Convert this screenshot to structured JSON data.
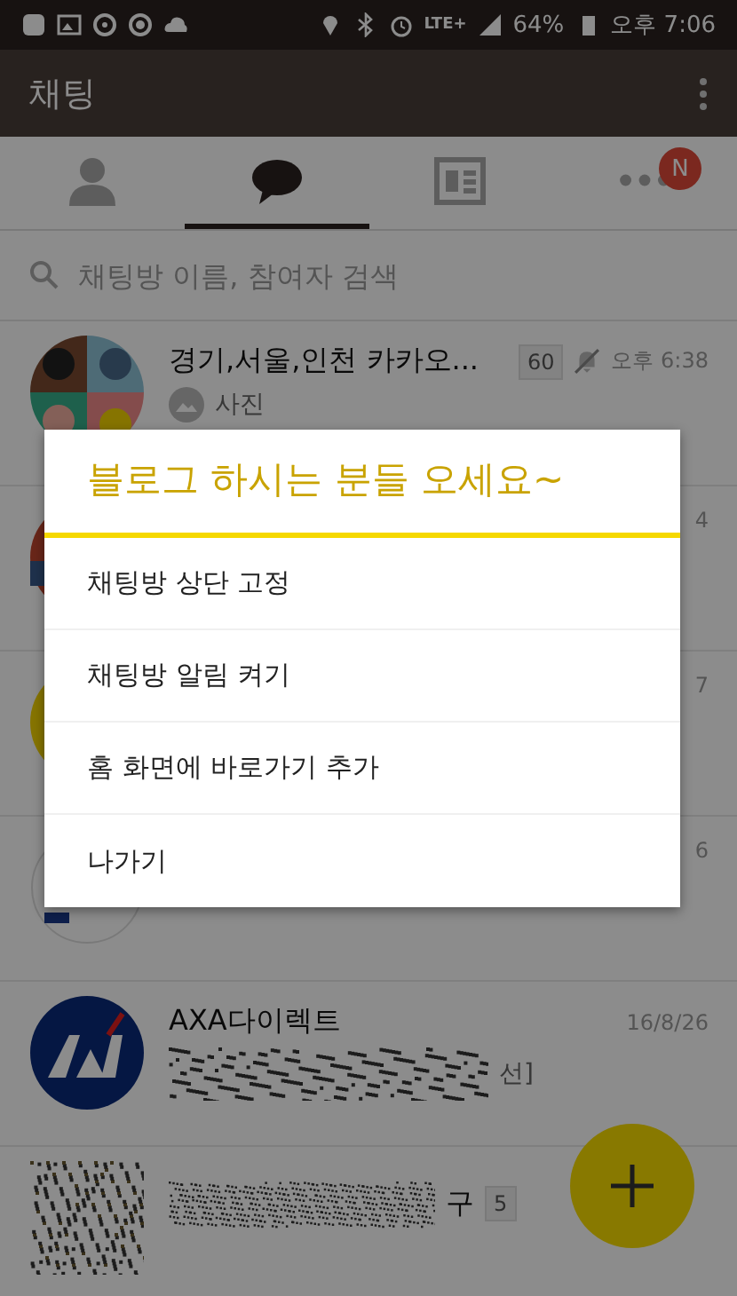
{
  "status_bar": {
    "network": "LTE+",
    "battery": "64%",
    "time": "오후 7:06"
  },
  "app_bar": {
    "title": "채팅"
  },
  "tabs": [
    {
      "kind": "friends",
      "selected": false
    },
    {
      "kind": "chats",
      "selected": true
    },
    {
      "kind": "news",
      "selected": false
    },
    {
      "kind": "more",
      "selected": false,
      "badge": "N"
    }
  ],
  "search": {
    "placeholder": "채팅방 이름, 참여자 검색"
  },
  "chats": [
    {
      "kind": "group",
      "name": "경기,서울,인천 카카오...",
      "members": "60",
      "muted": true,
      "time": "오후 6:38",
      "preview": {
        "kind": "photo",
        "text": "사진"
      }
    },
    {
      "kind": "red",
      "time": "4"
    },
    {
      "kind": "yellow",
      "time": "7"
    },
    {
      "kind": "white",
      "time": "6"
    },
    {
      "kind": "axa",
      "name": "AXA다이렉트",
      "time": "16/8/26",
      "preview": {
        "kind": "redacted",
        "text": "선]"
      }
    },
    {
      "kind": "redacted",
      "name": "구",
      "members": "5"
    }
  ],
  "dialog": {
    "title": "블로그 하시는 분들 오세요~",
    "items": [
      "채팅방 상단 고정",
      "채팅방 알림 켜기",
      "홈 화면에 바로가기 추가",
      "나가기"
    ]
  }
}
